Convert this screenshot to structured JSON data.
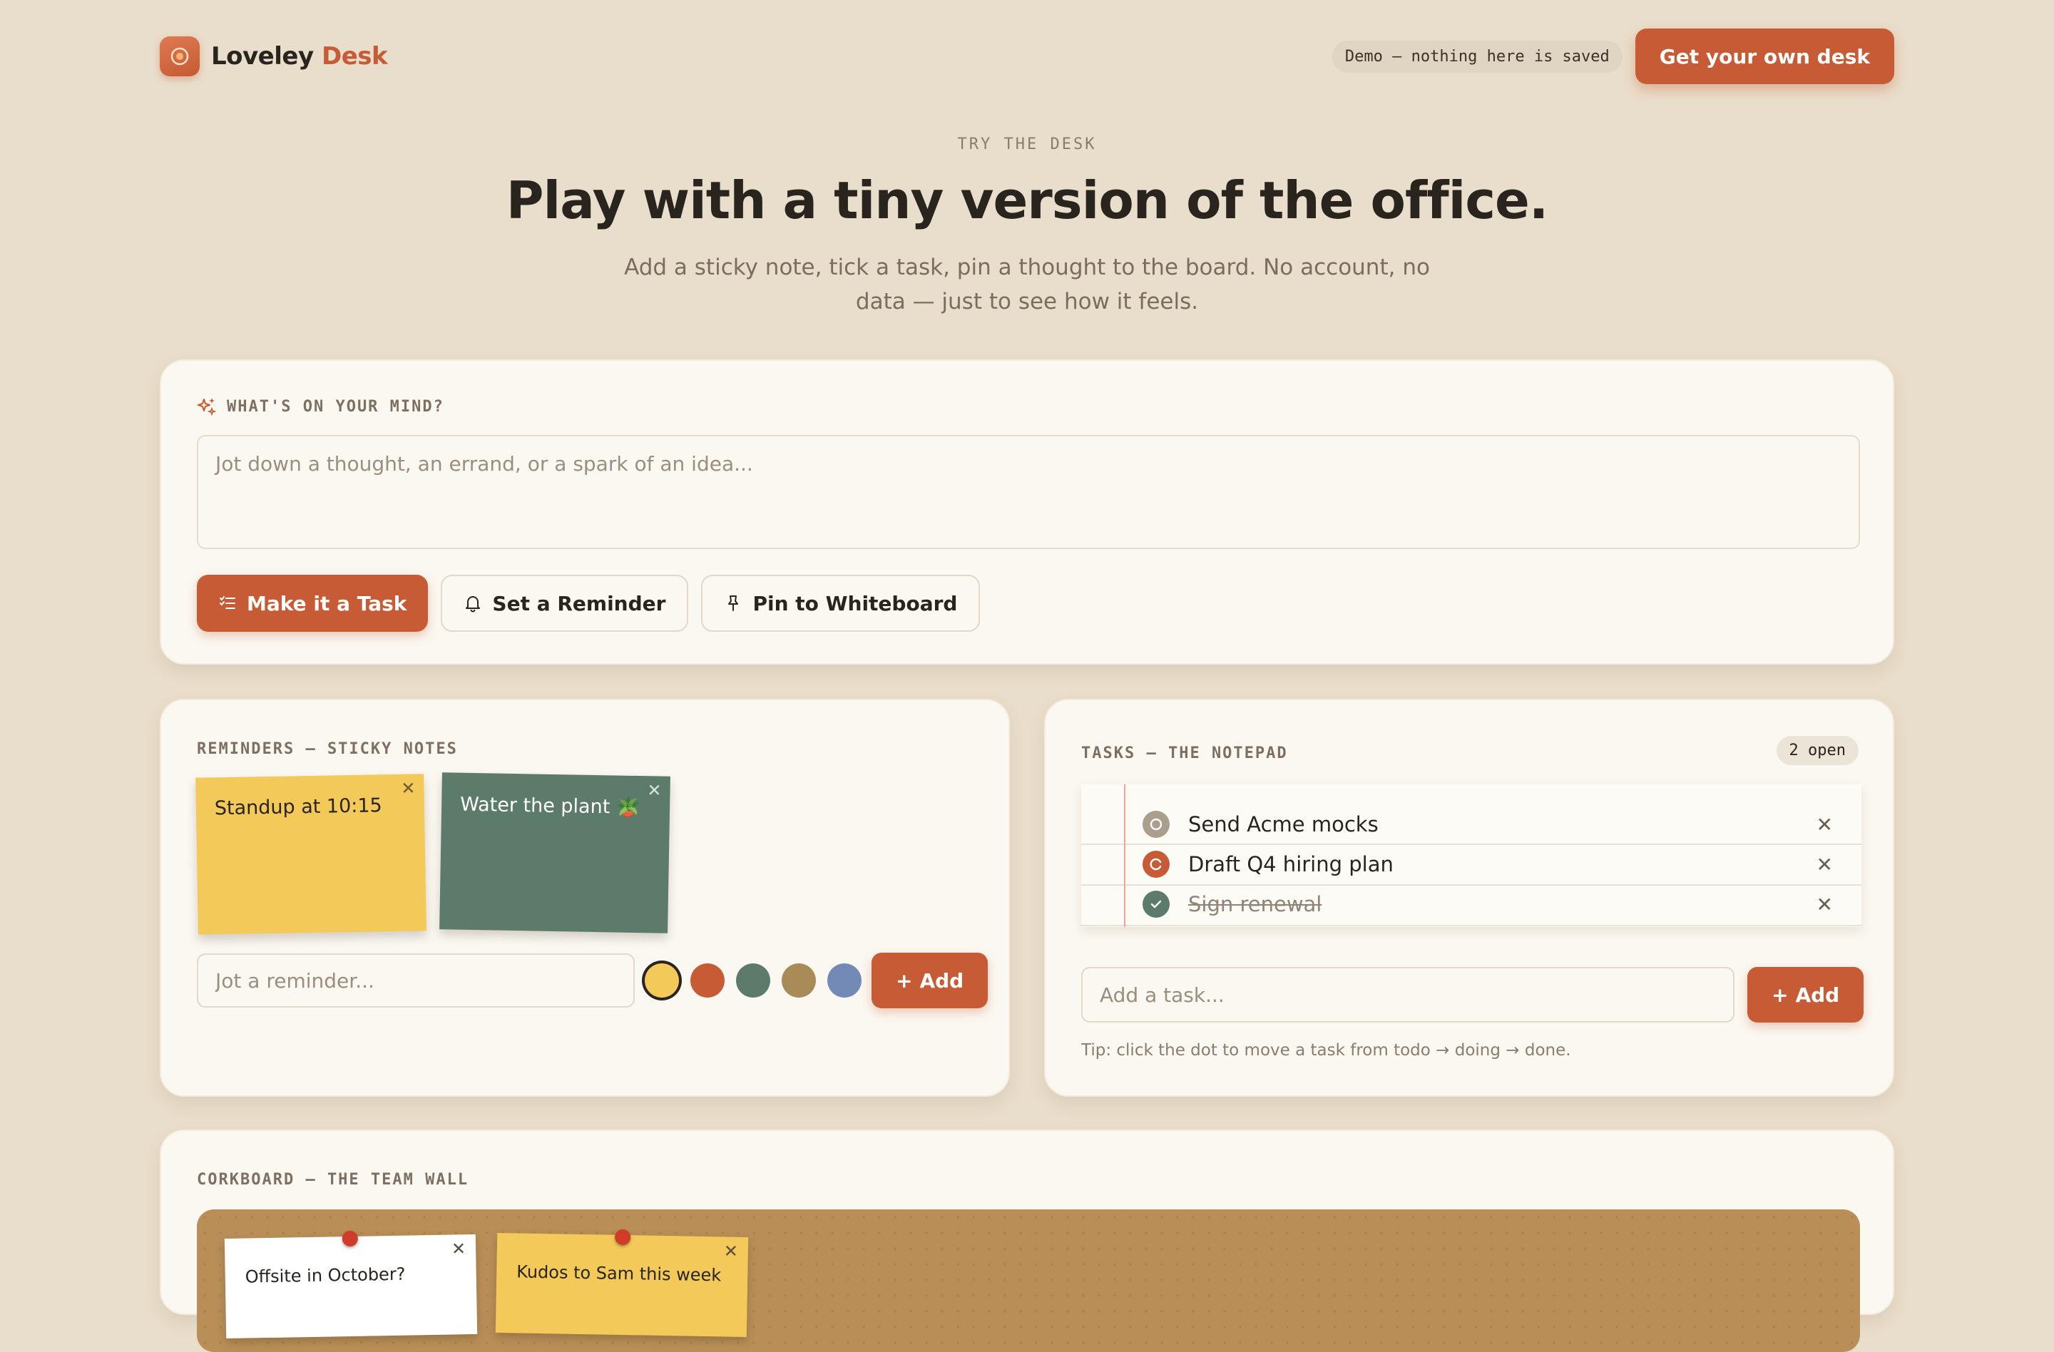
{
  "brand": {
    "name": "Loveley",
    "name_accent": "Desk"
  },
  "header": {
    "demo_badge": "Demo — nothing here is saved",
    "cta_label": "Get your own desk"
  },
  "hero": {
    "eyebrow": "TRY THE DESK",
    "title": "Play with a tiny version of the office.",
    "subtitle": "Add a sticky note, tick a task, pin a thought to the board. No account, no data — just to see how it feels."
  },
  "composer": {
    "label": "WHAT'S ON YOUR MIND?",
    "placeholder": "Jot down a thought, an errand, or a spark of an idea...",
    "actions": [
      {
        "label": "Make it a Task",
        "icon": "task-list-icon"
      },
      {
        "label": "Set a Reminder",
        "icon": "bell-icon"
      },
      {
        "label": "Pin to Whiteboard",
        "icon": "pin-icon"
      }
    ]
  },
  "reminders": {
    "label": "REMINDERS — STICKY NOTES",
    "notes": [
      {
        "text": "Standup at 10:15",
        "color": "#f3c95a"
      },
      {
        "text": "Water the plant 🪴",
        "color": "#5c7b6b"
      }
    ],
    "input_placeholder": "Jot a reminder...",
    "colors": [
      "#f3c95a",
      "#c65b35",
      "#5c7b6b",
      "#a98b57",
      "#7389b6"
    ],
    "selected_color": "#f3c95a",
    "add_label": "Add"
  },
  "tasks": {
    "label": "TASKS — THE NOTEPAD",
    "open_count": "2 open",
    "items": [
      {
        "text": "Send Acme mocks",
        "status": "todo"
      },
      {
        "text": "Draft Q4 hiring plan",
        "status": "doing"
      },
      {
        "text": "Sign renewal",
        "status": "done"
      }
    ],
    "input_placeholder": "Add a task...",
    "add_label": "Add",
    "tip": "Tip: click the dot to move a task from todo → doing → done."
  },
  "corkboard": {
    "label": "CORKBOARD — THE TEAM WALL",
    "notes": [
      {
        "text": "Offsite in October?",
        "color": "#ffffff"
      },
      {
        "text": "Kudos to Sam this week",
        "color": "#f3c95a"
      }
    ]
  },
  "colors": {
    "accent": "#c65b35",
    "background": "#e9decb",
    "card": "#fbf8f1",
    "sage": "#5c7b6b",
    "mustard": "#f3c95a"
  }
}
